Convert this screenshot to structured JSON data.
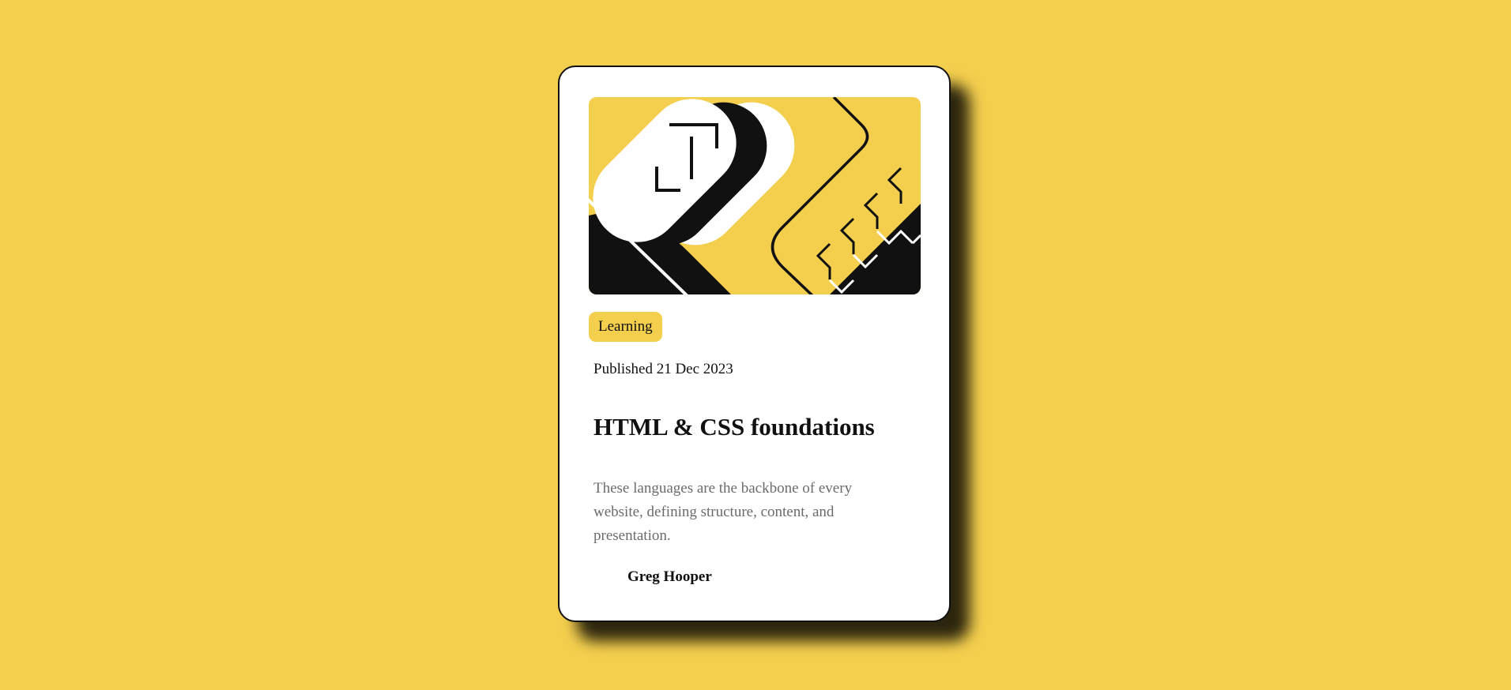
{
  "colors": {
    "page_background": "#f4cf4e",
    "card_background": "#ffffff",
    "accent": "#f4cf4e",
    "text_primary": "#111111",
    "text_muted": "#6b6b6b"
  },
  "card": {
    "illustration_icon": "abstract-code-illustration",
    "tag": "Learning",
    "published": "Published 21 Dec 2023",
    "title": "HTML & CSS foundations",
    "description": "These languages are the backbone of every website, defining structure, content, and presentation.",
    "author": {
      "avatar_icon": "avatar-image",
      "name": "Greg Hooper"
    }
  }
}
